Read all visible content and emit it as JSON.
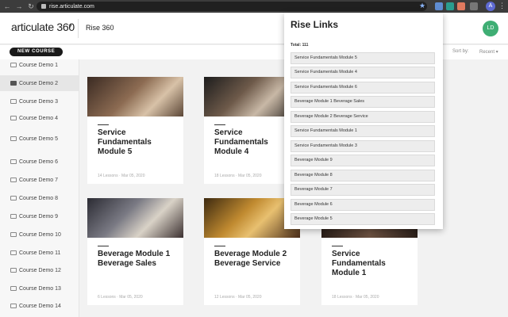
{
  "browser": {
    "url": "rise.articulate.com",
    "profile_initial": "A"
  },
  "header": {
    "logo": "articulate 360",
    "section_title": "Rise 360",
    "avatar_initials": "LD"
  },
  "toolbar": {
    "new_course_label": "NEW COURSE",
    "sort_label": "Sort by:",
    "sort_value": "Recent ▾"
  },
  "sidebar": {
    "items": [
      {
        "label": "Course Demo 1"
      },
      {
        "label": "Course Demo 2",
        "active": true
      },
      {
        "label": "Course Demo 3"
      },
      {
        "label": "Course Demo 4"
      },
      {
        "label": "Course Demo 5"
      },
      {
        "label": "Course Demo 6"
      },
      {
        "label": "Course Demo 7"
      },
      {
        "label": "Course Demo 8"
      },
      {
        "label": "Course Demo 9"
      },
      {
        "label": "Course Demo 10"
      },
      {
        "label": "Course Demo 11"
      },
      {
        "label": "Course Demo 12"
      },
      {
        "label": "Course Demo 13"
      },
      {
        "label": "Course Demo 14"
      }
    ]
  },
  "courses": [
    {
      "title": "Service Fundamentals Module 5",
      "meta": "14 Lessons · Mar 05, 2020"
    },
    {
      "title": "Service Fundamentals Module 4",
      "meta": "18 Lessons · Mar 05, 2020"
    },
    {
      "title": "Beverage Module 1 Beverage Sales",
      "meta": "6 Lessons · Mar 05, 2020"
    },
    {
      "title": "Beverage Module 2 Beverage Service",
      "meta": "12 Lessons · Mar 05, 2020"
    },
    {
      "title": "Service Fundamentals Module 1",
      "meta": "18 Lessons · Mar 05, 2020"
    }
  ],
  "popup": {
    "title": "Rise Links",
    "total": "Total: 111",
    "links": [
      "Service Fundamentals Module 5",
      "Service Fundamentals Module 4",
      "Service Fundamentals Module 6",
      "Beverage Module 1 Beverage Sales",
      "Beverage Module 2 Beverage Service",
      "Service Fundamentals Module 1",
      "Service Fundamentals Module 3",
      "Beverage Module 9",
      "Beverage Module 8",
      "Beverage Module 7",
      "Beverage Module 6",
      "Beverage Module 5"
    ]
  },
  "colors": {
    "avatar": "#3fae74",
    "new_course_bg": "#1a1a1a"
  }
}
